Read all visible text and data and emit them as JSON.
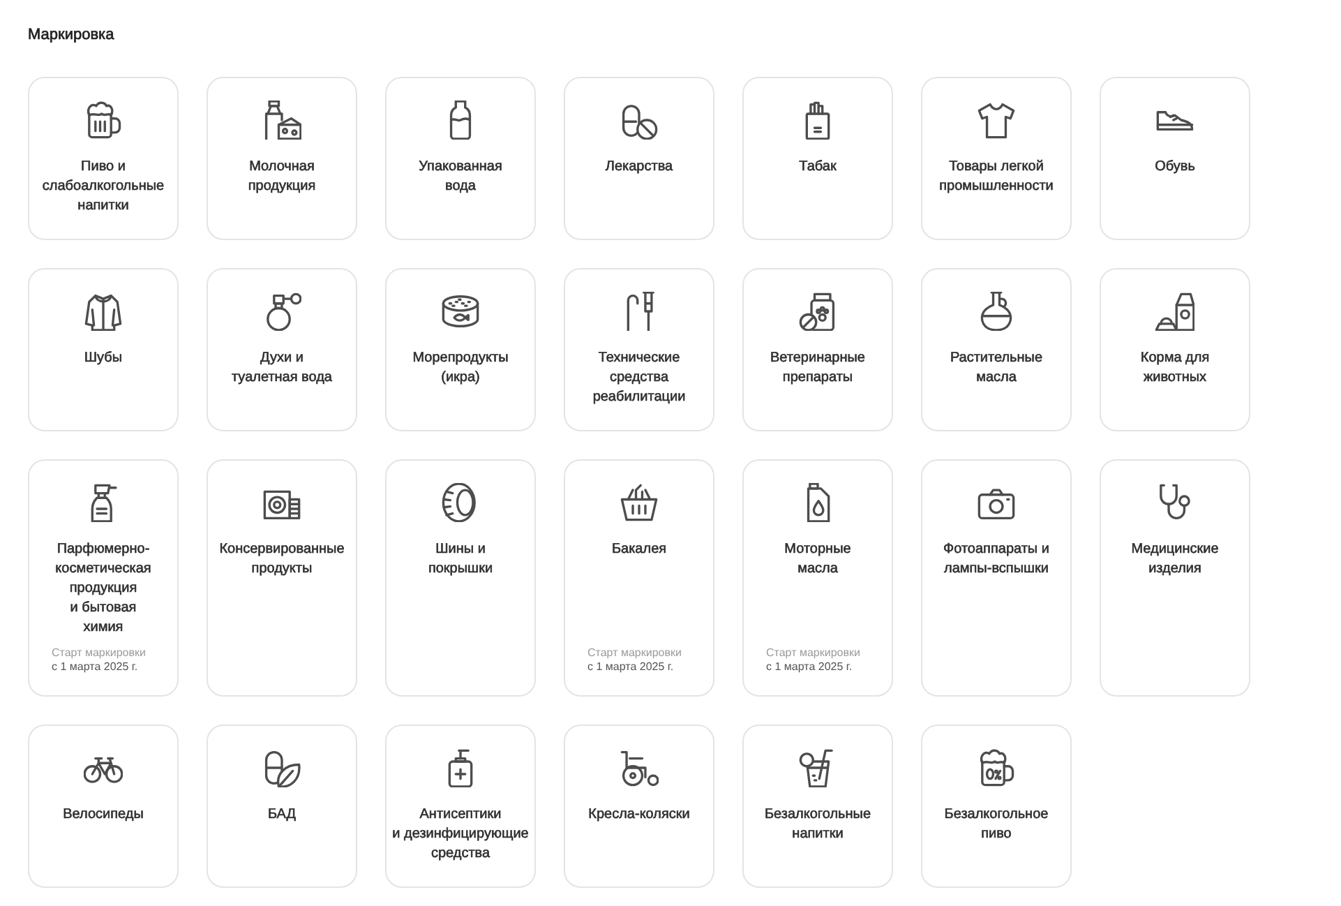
{
  "heading": "Маркировка",
  "categories": [
    {
      "title": "Пиво и\nслабоалкогольные\nнапитки"
    },
    {
      "title": "Молочная\nпродукция"
    },
    {
      "title": "Упакованная\nвода"
    },
    {
      "title": "Лекарства"
    },
    {
      "title": "Табак"
    },
    {
      "title": "Товары легкой\nпромышленности"
    },
    {
      "title": "Обувь"
    },
    {
      "title": "Шубы"
    },
    {
      "title": "Духи и\nтуалетная вода"
    },
    {
      "title": "Морепродукты\n(икра)"
    },
    {
      "title": "Технические\nсредства\nреабилитации"
    },
    {
      "title": "Ветеринарные\nпрепараты"
    },
    {
      "title": "Растительные\nмасла"
    },
    {
      "title": "Корма для\nживотных"
    },
    {
      "title": "Парфюмерно-\nкосметическая\nпродукция\nи бытовая\nхимия",
      "note": {
        "label": "Старт маркировки",
        "date": "с 1 марта 2025 г."
      }
    },
    {
      "title": "Консервированные\nпродукты"
    },
    {
      "title": "Шины и\nпокрышки"
    },
    {
      "title": "Бакалея",
      "note": {
        "label": "Старт маркировки",
        "date": "с 1 марта 2025 г."
      }
    },
    {
      "title": "Моторные\nмасла",
      "note": {
        "label": "Старт маркировки",
        "date": "с 1 марта 2025 г."
      }
    },
    {
      "title": "Фотоаппараты и\nлампы-вспышки"
    },
    {
      "title": "Медицинские\nизделия"
    },
    {
      "title": "Велосипеды"
    },
    {
      "title": "БАД"
    },
    {
      "title": "Антисептики\nи дезинфицирующие\nсредства"
    },
    {
      "title": "Кресла-коляски"
    },
    {
      "title": "Безалкогольные\nнапитки"
    },
    {
      "title": "Безалкогольное\nпиво"
    }
  ]
}
